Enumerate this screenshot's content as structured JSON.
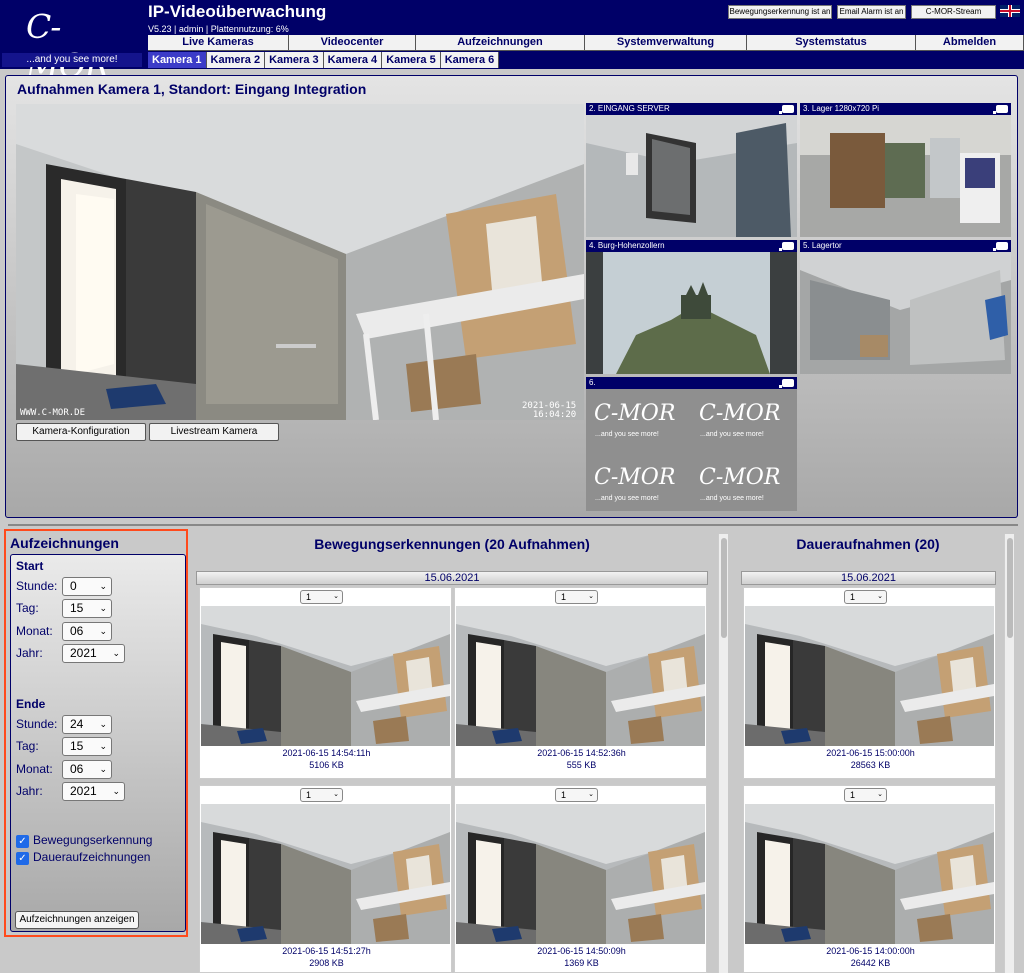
{
  "header": {
    "logo_text": "C-MOR",
    "logo_tagline": "...and you see more!",
    "title": "IP-Videoüberwachung",
    "subtitle": "V5.23 | admin | Plattennutzung: 6%",
    "buttons": [
      "Bewegungserkennung ist an",
      "Email Alarm ist an",
      "C-MOR-Stream"
    ],
    "language_icon": "uk-flag-icon"
  },
  "nav": {
    "items": [
      "Live Kameras",
      "Videocenter",
      "Aufzeichnungen",
      "Systemverwaltung",
      "Systemstatus",
      "Abmelden"
    ]
  },
  "cameras": {
    "tabs": [
      "Kamera 1",
      "Kamera 2",
      "Kamera 3",
      "Kamera 4",
      "Kamera 5",
      "Kamera 6"
    ],
    "active": "Kamera 1"
  },
  "top": {
    "title": "Aufnahmen Kamera 1, Standort: Eingang Integration",
    "main_cam_watermark": "WWW.C-MOR.DE",
    "main_cam_timestamp": "2021-06-15\n16:04:20",
    "btn_config": "Kamera-Konfiguration",
    "btn_livestream": "Livestream Kamera",
    "thumbnails": [
      {
        "label": "2. EINGANG SERVER"
      },
      {
        "label": "3. Lager 1280x720 Pi"
      },
      {
        "label": "4. Burg-Hohenzollern"
      },
      {
        "label": "5. Lagertor"
      },
      {
        "label": "6."
      }
    ],
    "placeholder_logo": "C-MOR",
    "placeholder_tagline": "...and you see more!"
  },
  "filter": {
    "title": "Aufzeichnungen",
    "start_label": "Start",
    "end_label": "Ende",
    "labels": {
      "stunde": "Stunde:",
      "tag": "Tag:",
      "monat": "Monat:",
      "jahr": "Jahr:"
    },
    "start": {
      "stunde": "0",
      "tag": "15",
      "monat": "06",
      "jahr": "2021"
    },
    "end": {
      "stunde": "24",
      "tag": "15",
      "monat": "06",
      "jahr": "2021"
    },
    "checkboxes": [
      {
        "label": "Bewegungserkennung",
        "checked": true
      },
      {
        "label": "Daueraufzeichnungen",
        "checked": true
      }
    ],
    "show_button": "Aufzeichnungen anzeigen"
  },
  "motion": {
    "title": "Bewegungserkennungen (20 Aufnahmen)",
    "date": "15.06.2021",
    "cards": [
      {
        "select": "1",
        "time": "2021-06-15 14:54:11h",
        "size": "5106 KB"
      },
      {
        "select": "1",
        "time": "2021-06-15 14:52:36h",
        "size": "555 KB"
      },
      {
        "select": "1",
        "time": "2021-06-15 14:51:27h",
        "size": "2908 KB"
      },
      {
        "select": "1",
        "time": "2021-06-15 14:50:09h",
        "size": "1369 KB"
      }
    ]
  },
  "continuous": {
    "title": "Daueraufnahmen (20)",
    "date": "15.06.2021",
    "cards": [
      {
        "select": "1",
        "time": "2021-06-15 15:00:00h",
        "size": "28563 KB"
      },
      {
        "select": "1",
        "time": "2021-06-15 14:00:00h",
        "size": "26442 KB"
      }
    ]
  },
  "colors": {
    "brand_navy": "#000068",
    "highlight_border": "#ff4a1c",
    "active_tab": "#3c3cc8"
  }
}
